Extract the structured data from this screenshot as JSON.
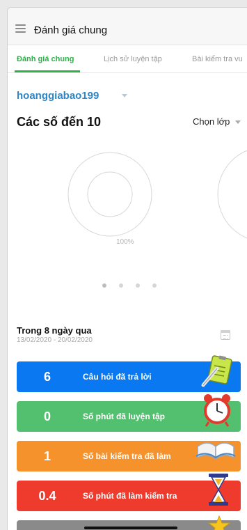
{
  "appbar": {
    "title": "Đánh giá chung"
  },
  "tabs": [
    {
      "label": "Đánh giá chung",
      "active": true
    },
    {
      "label": "Lịch sử luyện tập",
      "active": false
    },
    {
      "label": "Bài kiểm tra vu",
      "active": false
    }
  ],
  "profile": {
    "username": "hoanggiabao199"
  },
  "topic": {
    "title": "Các số đến 10",
    "class_selector": "Chọn lớp"
  },
  "progress": {
    "percent_label": "100%",
    "value": 1.0
  },
  "carousel": {
    "page_count": 4,
    "active_index": 0
  },
  "period": {
    "title": "Trong 8 ngày qua",
    "range": "13/02/2020 - 20/02/2020"
  },
  "stats": [
    {
      "value": "6",
      "label": "Câu hỏi đã trả lời",
      "color": "#0a78f0",
      "icon": "clipboard-pencil-icon"
    },
    {
      "value": "0",
      "label": "Số phút đã luyện tập",
      "color": "#53c06f",
      "icon": "alarm-clock-icon"
    },
    {
      "value": "1",
      "label": "Số bài kiểm tra đã làm",
      "color": "#f5922c",
      "icon": "open-book-icon"
    },
    {
      "value": "0.4",
      "label": "Số phút đã làm kiểm tra",
      "color": "#ef3b2d",
      "icon": "hourglass-icon"
    },
    {
      "value": "",
      "label": "",
      "color": "#8a8a8a",
      "icon": "star-icon"
    }
  ],
  "colors": {
    "accent": "#2fb24a",
    "link": "#2b86c8"
  }
}
